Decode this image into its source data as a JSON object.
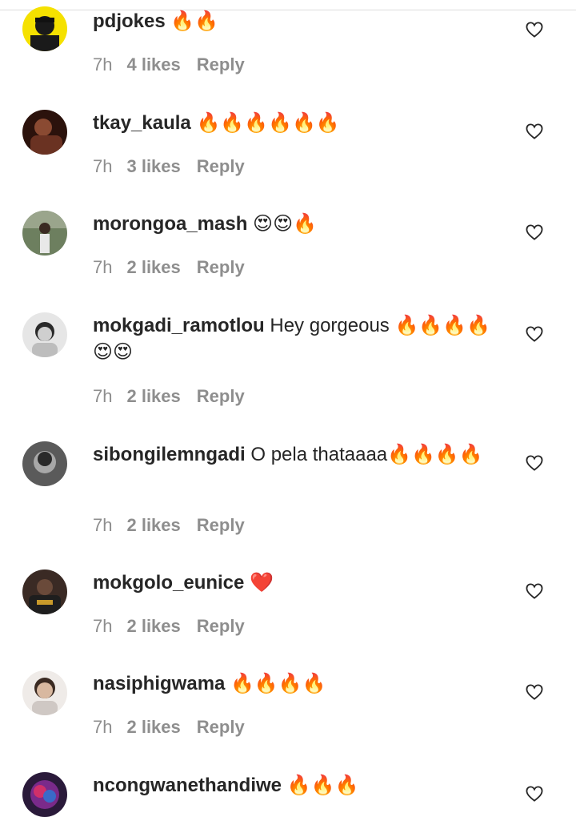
{
  "comments": [
    {
      "username": "pdjokes",
      "text": " ",
      "emoji": "🔥🔥",
      "time": "7h",
      "likes": "4 likes",
      "reply": "Reply",
      "avatar_color": "#f5e100"
    },
    {
      "username": "tkay_kaula",
      "text": " ",
      "emoji": "🔥🔥🔥🔥🔥🔥",
      "time": "7h",
      "likes": "3 likes",
      "reply": "Reply",
      "avatar_color": "#5a2a1e"
    },
    {
      "username": "morongoa_mash",
      "text": " ",
      "emoji": "😍😍🔥",
      "time": "7h",
      "likes": "2 likes",
      "reply": "Reply",
      "avatar_color": "#6d7f5f"
    },
    {
      "username": "mokgadi_ramotlou",
      "text": " Hey gorgeous ",
      "emoji": "🔥🔥🔥🔥😍😍",
      "time": "7h",
      "likes": "2 likes",
      "reply": "Reply",
      "avatar_color": "#d8d8d8"
    },
    {
      "username": "sibongilemngadi",
      "text": " O pela thataaaa",
      "emoji": "🔥🔥🔥🔥",
      "time": "7h",
      "likes": "2 likes",
      "reply": "Reply",
      "avatar_color": "#8a8a8a"
    },
    {
      "username": "mokgolo_eunice",
      "text": " ",
      "emoji": "❤️",
      "time": "7h",
      "likes": "2 likes",
      "reply": "Reply",
      "avatar_color": "#3a2a24"
    },
    {
      "username": "nasiphigwama",
      "text": " ",
      "emoji": "🔥🔥🔥🔥",
      "time": "7h",
      "likes": "2 likes",
      "reply": "Reply",
      "avatar_color": "#e8e2de"
    },
    {
      "username": "ncongwanethandiwe",
      "text": " ",
      "emoji": "🔥🔥🔥",
      "time": "",
      "likes": "",
      "reply": "",
      "avatar_color": "#7a2a8a"
    }
  ],
  "icons": {
    "like": "heart-outline-icon"
  },
  "colors": {
    "text": "#262626",
    "meta": "#8e8e8e"
  }
}
